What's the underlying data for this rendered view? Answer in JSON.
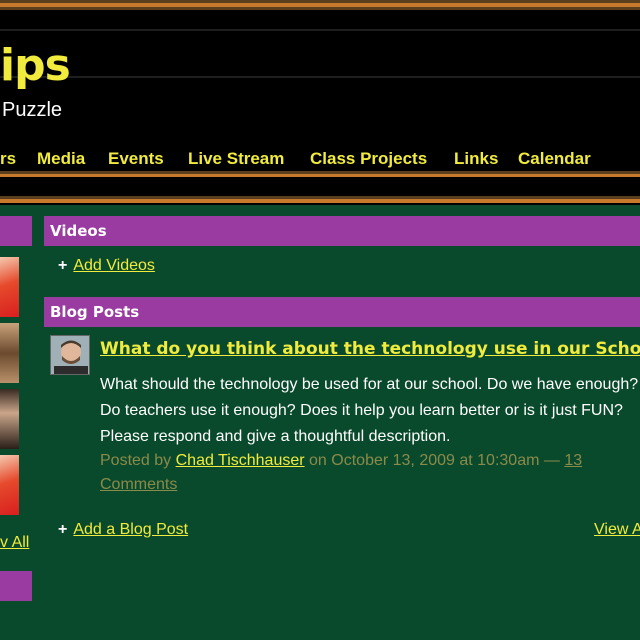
{
  "header": {
    "title": "ips",
    "tagline": "Puzzle"
  },
  "nav": {
    "items": [
      "rs",
      "Media",
      "Events",
      "Live Stream",
      "Class Projects",
      "Links",
      "Calendar"
    ]
  },
  "sidebar": {
    "view_all": "v All"
  },
  "videos": {
    "heading": "Videos",
    "add_label": "Add Videos",
    "plus": "+"
  },
  "blog": {
    "heading": "Blog Posts",
    "post": {
      "title": "What do you think about the technology use in our School",
      "body": "What should the technology be used for at our school. Do we have enough? Do teachers use it enough? Does it help you learn better or is it just FUN? Please respond and give a thoughtful description.",
      "posted_by": "Posted by",
      "author": "Chad Tischhauser",
      "date_text": "on October 13, 2009 at 10:30am —",
      "comments": "13 Comments"
    },
    "add_label": "Add a Blog Post",
    "plus": "+",
    "view_all": "View A"
  },
  "colors": {
    "background": "#0a4a2c",
    "section_header": "#9a3ba1",
    "link_yellow": "#f0eb3c",
    "header_bg": "#000000",
    "accent_orange": "#c77a2b"
  }
}
